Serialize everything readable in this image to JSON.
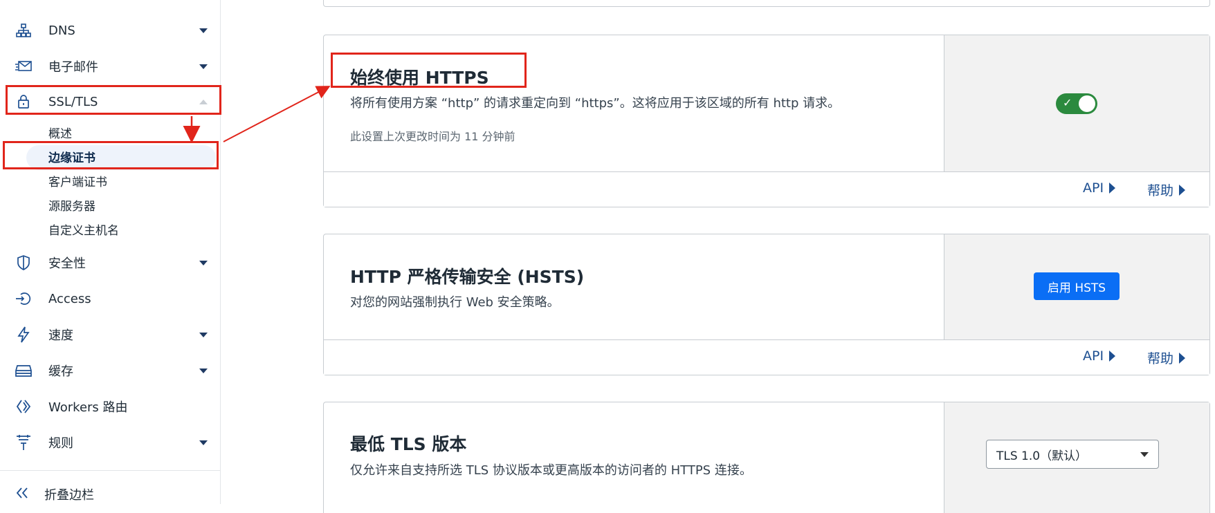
{
  "sidebar": {
    "items": {
      "dns": {
        "label": "DNS",
        "icon": "dns-network-icon"
      },
      "email": {
        "label": "电子邮件",
        "icon": "email-icon"
      },
      "ssl": {
        "label": "SSL/TLS",
        "icon": "lock-icon"
      },
      "security": {
        "label": "安全性",
        "icon": "shield-icon"
      },
      "access": {
        "label": "Access",
        "icon": "access-icon"
      },
      "speed": {
        "label": "速度",
        "icon": "lightning-icon"
      },
      "cache": {
        "label": "缓存",
        "icon": "cache-icon"
      },
      "workers": {
        "label": "Workers 路由",
        "icon": "workers-icon"
      },
      "rules": {
        "label": "规则",
        "icon": "rules-icon"
      }
    },
    "ssl_subitems": {
      "overview": "概述",
      "edge_cert": "边缘证书",
      "client_cert": "客户端证书",
      "origin_server": "源服务器",
      "custom_hostnames": "自定义主机名"
    },
    "collapse_label": "折叠边栏"
  },
  "cards": {
    "always_https": {
      "title": "始终使用 HTTPS",
      "desc": "将所有使用方案 “http” 的请求重定向到 “https”。这将应用于该区域的所有 http 请求。",
      "meta": "此设置上次更改时间为 11 分钟前",
      "toggle_on": true,
      "api_label": "API",
      "help_label": "帮助"
    },
    "hsts": {
      "title": "HTTP 严格传输安全 (HSTS)",
      "desc": "对您的网站强制执行 Web 安全策略。",
      "button_label": "启用 HSTS",
      "api_label": "API",
      "help_label": "帮助"
    },
    "min_tls": {
      "title": "最低 TLS 版本",
      "desc": "仅允许来自支持所选 TLS 协议版本或更高版本的访问者的 HTTPS 连接。",
      "select_value": "TLS 1.0（默认）"
    }
  },
  "colors": {
    "accent_blue": "#1d4f91",
    "primary_button": "#0a6ef5",
    "toggle_green": "#2b8a3e",
    "annotation_red": "#e1251b"
  }
}
